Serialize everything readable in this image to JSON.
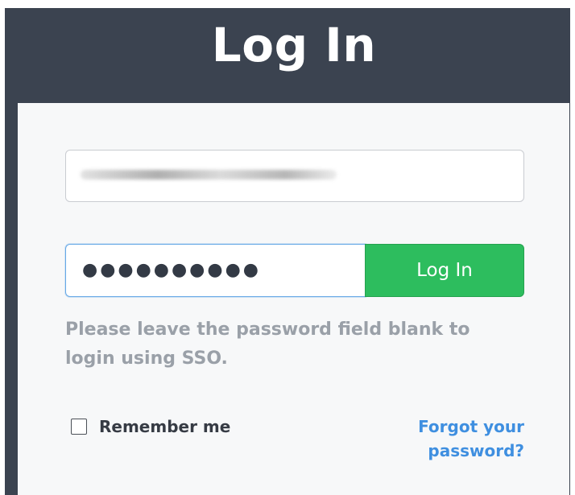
{
  "header": {
    "title": "Log In"
  },
  "form": {
    "email": {
      "value": "",
      "note": "value obscured/blurred in screenshot"
    },
    "password": {
      "masked_value": "●●●●●●●●●●"
    },
    "login_button_label": "Log In",
    "sso_hint": "Please leave the password field blank to login using SSO.",
    "remember_label": "Remember me",
    "remember_checked": false,
    "forgot_link": "Forgot your password?"
  },
  "colors": {
    "header_bg": "#3b4350",
    "panel_bg": "#f7f8f9",
    "button_green": "#2dbd5e",
    "link_blue": "#3f8fe0",
    "hint_gray": "#9aa0a8",
    "focus_border": "#66a8e6"
  }
}
